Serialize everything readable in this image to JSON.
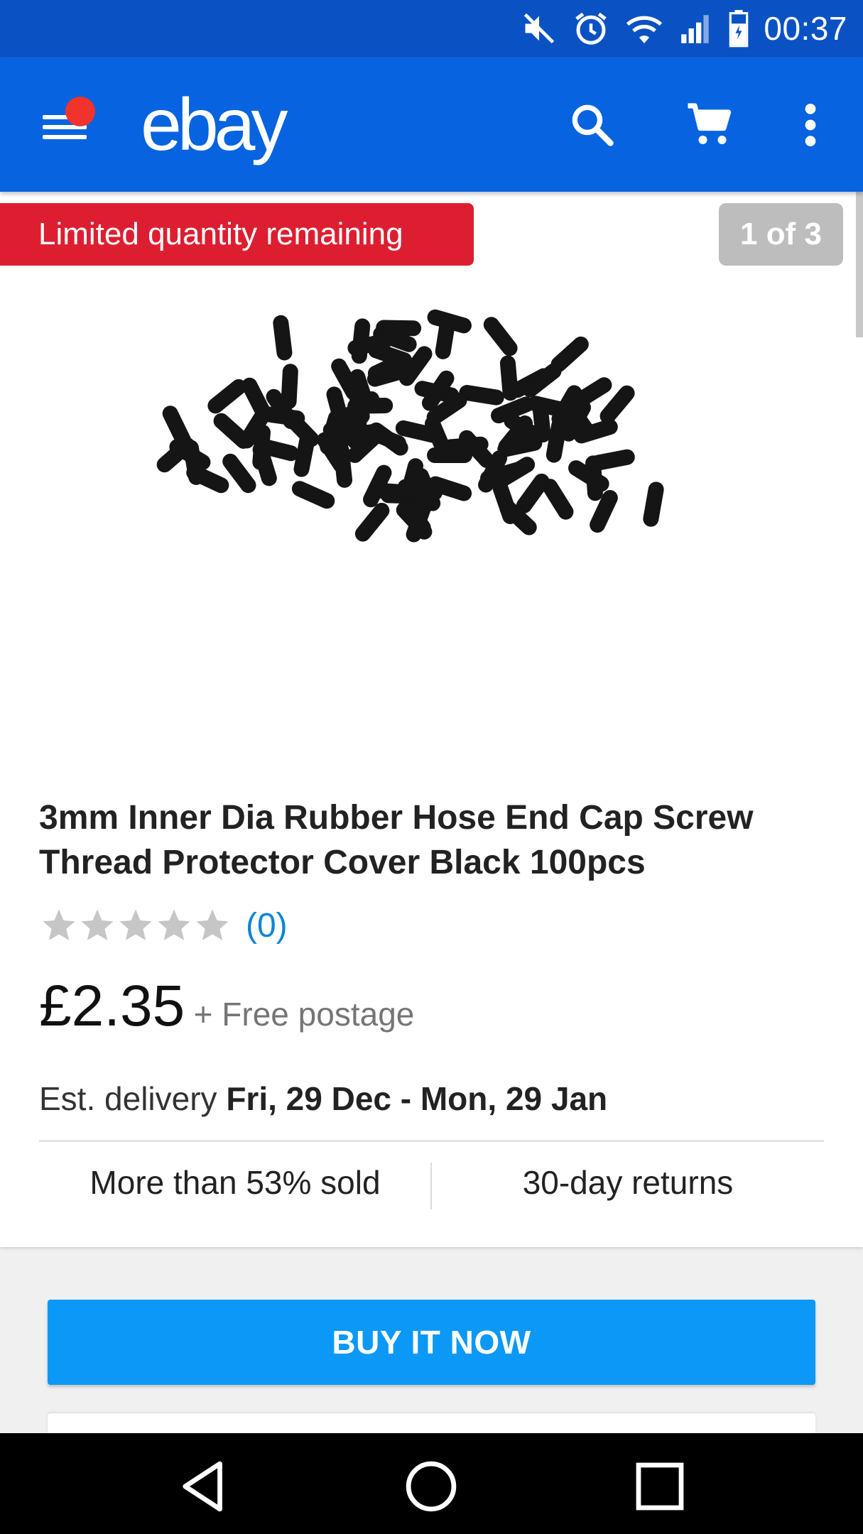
{
  "status_bar": {
    "time": "00:37",
    "icons": [
      "mute-icon",
      "alarm-icon",
      "wifi-icon",
      "signal-icon",
      "battery-icon"
    ]
  },
  "app_bar": {
    "logo": "ebay",
    "icons": [
      "menu-icon",
      "search-icon",
      "cart-icon",
      "more-icon"
    ],
    "notification_dot": true
  },
  "product": {
    "badge_limited": "Limited quantity remaining",
    "image_counter": "1 of 3",
    "title": "3mm Inner Dia Rubber Hose End Cap Screw Thread Protector Cover Black 100pcs",
    "rating": {
      "stars_filled": 0,
      "stars_total": 5,
      "count": "(0)"
    },
    "price": "£2.35",
    "postage": "+ Free postage",
    "delivery_label": "Est. delivery",
    "delivery_dates": "Fri, 29 Dec - Mon, 29 Jan",
    "sold": "More than 53% sold",
    "returns": "30-day returns"
  },
  "actions": {
    "buy_now": "BUY IT NOW"
  },
  "nav": {
    "icons": [
      "back-icon",
      "home-icon",
      "recents-icon"
    ]
  },
  "colors": {
    "status_bar": "#0a52c4",
    "app_bar": "#0763e0",
    "badge_red": "#dd1e31",
    "buy_button": "#0b98f6",
    "link_blue": "#0d85d9"
  }
}
